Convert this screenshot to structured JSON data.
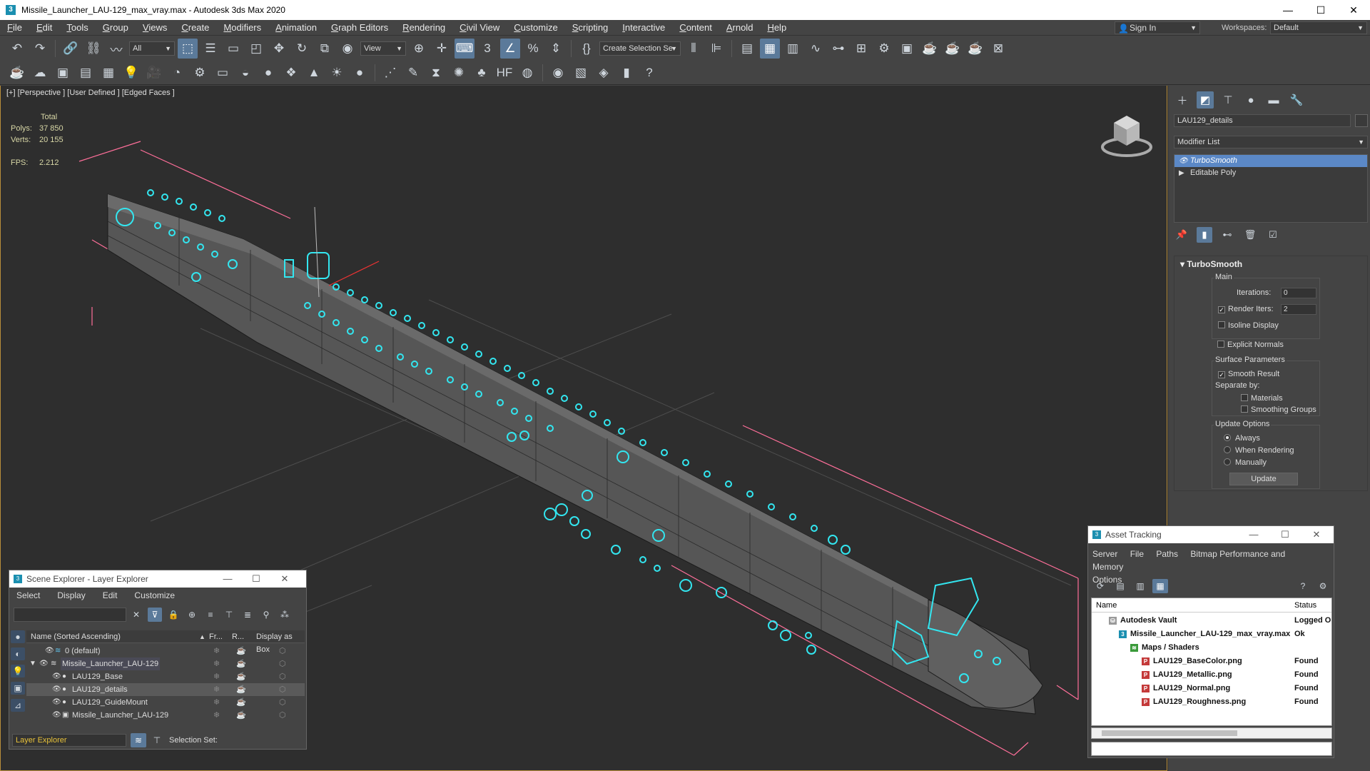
{
  "window": {
    "title": "Missile_Launcher_LAU-129_max_vray.max - Autodesk 3ds Max 2020"
  },
  "menu": [
    "File",
    "Edit",
    "Tools",
    "Group",
    "Views",
    "Create",
    "Modifiers",
    "Animation",
    "Graph Editors",
    "Rendering",
    "Civil View",
    "Customize",
    "Scripting",
    "Interactive",
    "Content",
    "Arnold",
    "Help"
  ],
  "header": {
    "sign_in": "Sign In",
    "workspaces_label": "Workspaces:",
    "workspace": "Default"
  },
  "toolbar": {
    "filter": "All",
    "ref_coord": "View",
    "selection_set": "Create Selection Se"
  },
  "viewport": {
    "label": "[+] [Perspective ] [User Defined ] [Edged Faces ]",
    "stats": {
      "total": "Total",
      "polys_label": "Polys:",
      "polys": "37 850",
      "verts_label": "Verts:",
      "verts": "20 155",
      "fps_label": "FPS:",
      "fps": "2.212"
    }
  },
  "command_panel": {
    "object_name": "LAU129_details",
    "modifier_list": "Modifier List",
    "stack": [
      "TurboSmooth",
      "Editable Poly"
    ],
    "rollout": {
      "title": "TurboSmooth",
      "main": "Main",
      "iterations_label": "Iterations:",
      "iterations": "0",
      "render_iters_label": "Render Iters:",
      "render_iters": "2",
      "isoline": "Isoline Display",
      "explicit_normals": "Explicit Normals",
      "surface_params": "Surface Parameters",
      "smooth_result": "Smooth Result",
      "separate_by": "Separate by:",
      "materials": "Materials",
      "smoothing_groups": "Smoothing Groups",
      "update_options": "Update Options",
      "always": "Always",
      "when_rendering": "When Rendering",
      "manually": "Manually",
      "update": "Update"
    }
  },
  "scene_explorer": {
    "title": "Scene Explorer - Layer Explorer",
    "menu": [
      "Select",
      "Display",
      "Edit",
      "Customize"
    ],
    "columns": {
      "name": "Name (Sorted Ascending)",
      "sort": "▲",
      "freeze": "Fr...",
      "render": "R...",
      "box": "Display as Box"
    },
    "rows": [
      {
        "name": "0 (default)"
      },
      {
        "name": "Missile_Launcher_LAU-129"
      },
      {
        "name": "LAU129_Base"
      },
      {
        "name": "LAU129_details"
      },
      {
        "name": "LAU129_GuideMount"
      },
      {
        "name": "Missile_Launcher_LAU-129"
      }
    ],
    "layer_explorer": "Layer Explorer",
    "selection_set": "Selection Set:"
  },
  "asset_tracking": {
    "title": "Asset Tracking",
    "menu": [
      "Server",
      "File",
      "Paths",
      "Bitmap Performance and Memory"
    ],
    "menu2": "Options",
    "columns": {
      "name": "Name",
      "status": "Status"
    },
    "rows": [
      {
        "name": "Autodesk Vault",
        "status": "Logged O"
      },
      {
        "name": "Missile_Launcher_LAU-129_max_vray.max",
        "status": "Ok"
      },
      {
        "name": "Maps / Shaders",
        "status": ""
      },
      {
        "name": "LAU129_BaseColor.png",
        "status": "Found"
      },
      {
        "name": "LAU129_Metallic.png",
        "status": "Found"
      },
      {
        "name": "LAU129_Normal.png",
        "status": "Found"
      },
      {
        "name": "LAU129_Roughness.png",
        "status": "Found"
      }
    ]
  },
  "colors": {
    "accent": "#5b88c6",
    "viewport_bg": "#2e2e2e",
    "selection": "#33e6f0",
    "layer_text": "#e8c23a"
  }
}
